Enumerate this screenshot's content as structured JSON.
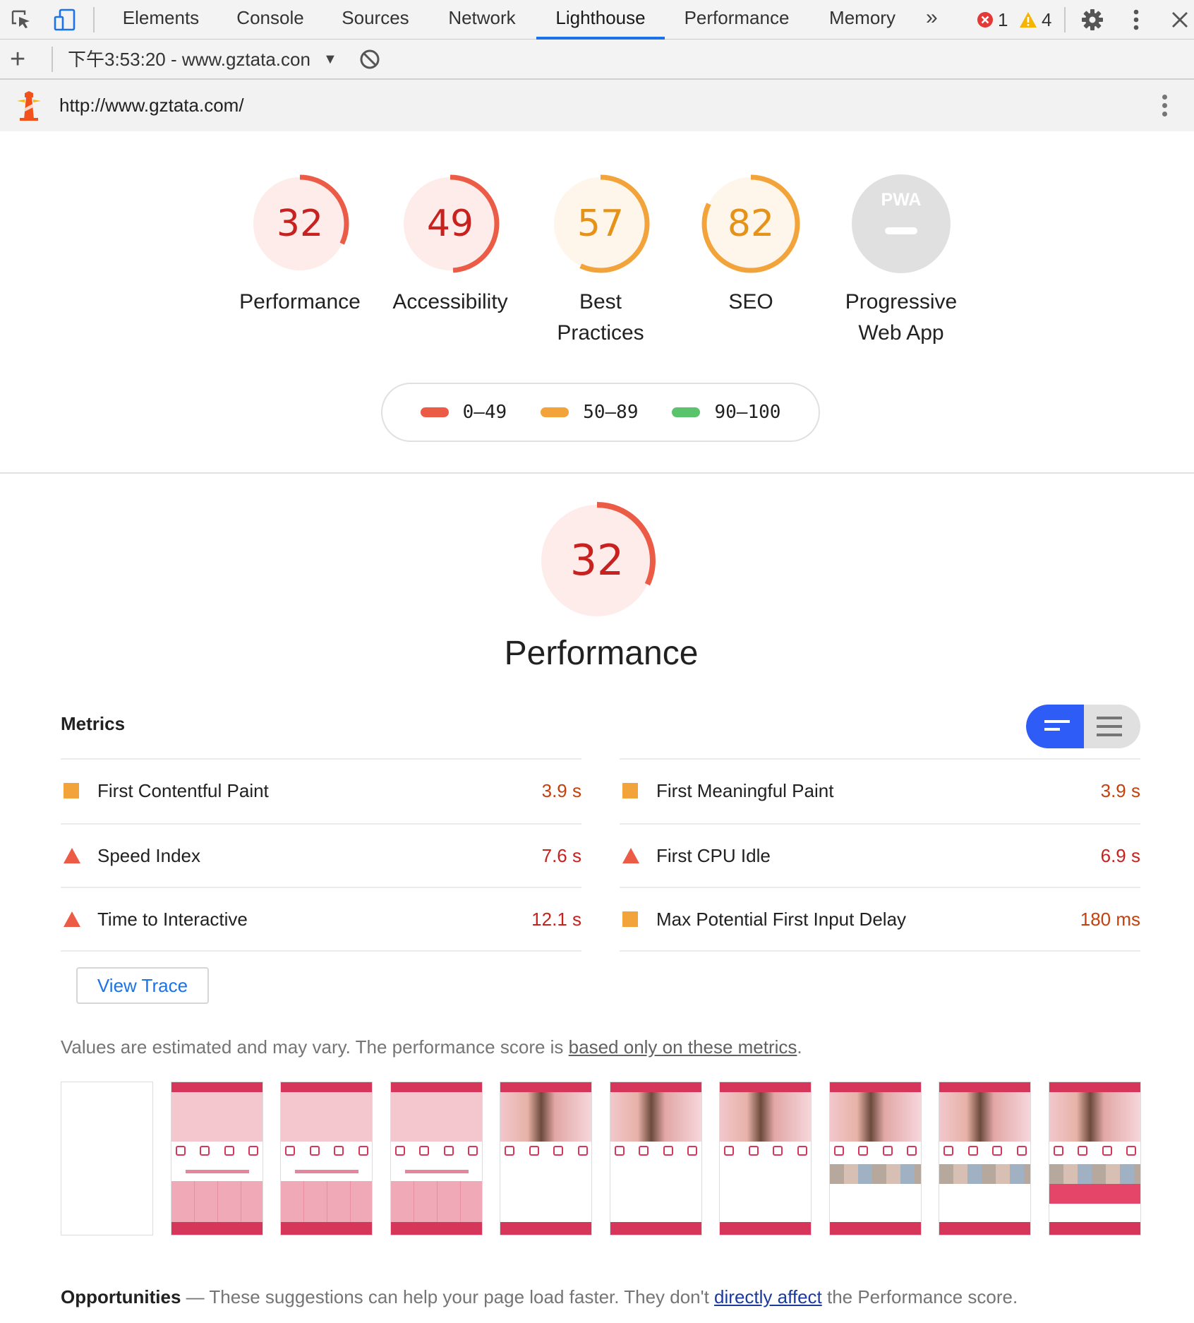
{
  "devtools": {
    "tabs": [
      {
        "label": "Elements"
      },
      {
        "label": "Console"
      },
      {
        "label": "Sources"
      },
      {
        "label": "Network"
      },
      {
        "label": "Lighthouse",
        "active": true
      },
      {
        "label": "Performance"
      },
      {
        "label": "Memory"
      }
    ],
    "more_tabs_icon": "chevron-double-right-icon",
    "error_count": "1",
    "warning_count": "4",
    "colors": {
      "active_tab": "#1a73e8",
      "error": "#e53935",
      "warning": "#f4b400"
    }
  },
  "toolbar": {
    "report_select": "下午3:53:20 - www.gztata.con",
    "icons": [
      "plus-icon",
      "dropdown-arrow-icon",
      "clear-block-icon"
    ]
  },
  "urlbar": {
    "url": "http://www.gztata.com/",
    "icons": [
      "lighthouse-logo-icon",
      "more-vert-icon"
    ]
  },
  "scores": [
    {
      "value": "32",
      "score": 32,
      "label": "Performance",
      "color": "#eb5b46"
    },
    {
      "value": "49",
      "score": 49,
      "label": "Accessibility",
      "color": "#eb5b46"
    },
    {
      "value": "57",
      "score": 57,
      "label_lines": [
        "Best",
        "Practices"
      ],
      "color": "#f2a33a"
    },
    {
      "value": "82",
      "score": 82,
      "label": "SEO",
      "color": "#f2a33a"
    },
    {
      "value": "PWA",
      "label_lines": [
        "Progressive",
        "Web App"
      ],
      "color": "#e0e0e0"
    }
  ],
  "legend": [
    {
      "range": "0–49",
      "color": "#eb5b46"
    },
    {
      "range": "50–89",
      "color": "#f2a33a"
    },
    {
      "range": "90–100",
      "color": "#5ac46c"
    }
  ],
  "performance": {
    "score": "32",
    "score_value": 32,
    "title": "Performance",
    "metrics_title": "Metrics",
    "view_toggle_icons": [
      "compact-view-icon",
      "expanded-view-icon"
    ],
    "metrics_left": [
      {
        "name": "First Contentful Paint",
        "value": "3.9 s",
        "rating": "average"
      },
      {
        "name": "Speed Index",
        "value": "7.6 s",
        "rating": "fail"
      },
      {
        "name": "Time to Interactive",
        "value": "12.1 s",
        "rating": "fail"
      }
    ],
    "metrics_right": [
      {
        "name": "First Meaningful Paint",
        "value": "3.9 s",
        "rating": "average"
      },
      {
        "name": "First CPU Idle",
        "value": "6.9 s",
        "rating": "fail"
      },
      {
        "name": "Max Potential First Input Delay",
        "value": "180 ms",
        "rating": "average"
      }
    ],
    "rating_colors": {
      "average": "#f2a33a",
      "fail": "#eb5b46",
      "average_text": "#c4410f",
      "fail_text": "#c7221f"
    },
    "view_trace": "View Trace",
    "note_prefix": "Values are estimated and may vary. The performance score is ",
    "note_link": "based only on these metrics",
    "note_suffix": "."
  },
  "filmstrip": {
    "frames": 10
  },
  "opportunities": {
    "title": "Opportunities",
    "dash": " — ",
    "text_prefix": "These suggestions can help your page load faster. They don't ",
    "link": "directly affect",
    "text_suffix": " the Performance score."
  }
}
